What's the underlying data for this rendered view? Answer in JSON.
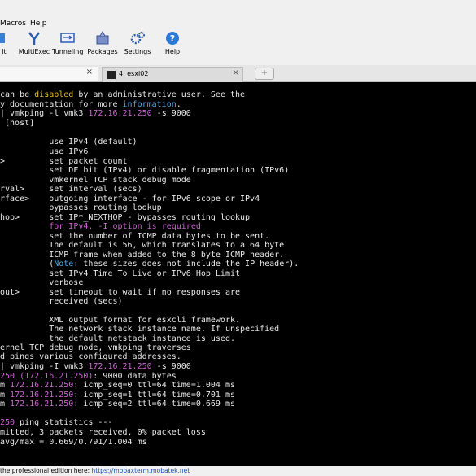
{
  "menubar": {
    "items": [
      "Macros",
      "Help"
    ]
  },
  "toolbar": {
    "buttons": [
      {
        "label": "it",
        "icon": "split-icon"
      },
      {
        "label": "MultiExec",
        "icon": "multiexec-icon"
      },
      {
        "label": "Tunneling",
        "icon": "tunneling-icon"
      },
      {
        "label": "Packages",
        "icon": "packages-icon"
      },
      {
        "label": "Settings",
        "icon": "settings-icon"
      },
      {
        "label": "Help",
        "icon": "help-icon"
      }
    ]
  },
  "tabs": {
    "active_close": "×",
    "session_tab": {
      "label": "4. esxi02",
      "close": "×"
    },
    "new_tab": "+"
  },
  "terminal": {
    "lines": [
      [
        {
          "t": "can be ",
          "c": "#e8e8e8"
        },
        {
          "t": "disabled",
          "c": "#e0c020"
        },
        {
          "t": " by an administrative user. See the",
          "c": "#e8e8e8"
        }
      ],
      [
        {
          "t": "y documentation for more ",
          "c": "#e8e8e8"
        },
        {
          "t": "information",
          "c": "#4aa8e8"
        },
        {
          "t": ".",
          "c": "#e8e8e8"
        }
      ],
      [
        {
          "t": "| vmkping -l vmk3 ",
          "c": "#e8e8e8"
        },
        {
          "t": "172.16.21.250",
          "c": "#d060d8"
        },
        {
          "t": " -s 9000",
          "c": "#e8e8e8"
        }
      ],
      [
        {
          "t": " [host]",
          "c": "#e8e8e8"
        }
      ],
      [
        {
          "t": "",
          "c": "#e8e8e8"
        }
      ],
      [
        {
          "t": "          use IPv4 (default)",
          "c": "#e8e8e8"
        }
      ],
      [
        {
          "t": "          use IPv6",
          "c": "#e8e8e8"
        }
      ],
      [
        {
          "t": ">         set packet count",
          "c": "#e8e8e8"
        }
      ],
      [
        {
          "t": "          set DF bit (IPv4) or disable fragmentation (IPv6)",
          "c": "#e8e8e8"
        }
      ],
      [
        {
          "t": "          vmkernel TCP stack debug mode",
          "c": "#e8e8e8"
        }
      ],
      [
        {
          "t": "rval>     set interval (secs)",
          "c": "#e8e8e8"
        }
      ],
      [
        {
          "t": "rface>    outgoing interface - for IPv6 scope or IPv4",
          "c": "#e8e8e8"
        }
      ],
      [
        {
          "t": "          bypasses routing lookup",
          "c": "#e8e8e8"
        }
      ],
      [
        {
          "t": "hop>      set IP*_NEXTHOP - bypasses routing lookup",
          "c": "#e8e8e8"
        }
      ],
      [
        {
          "t": "          ",
          "c": "#e8e8e8"
        },
        {
          "t": "for IPv4, -I option is required",
          "c": "#d060d8"
        }
      ],
      [
        {
          "t": "          set the number of ICMP data bytes to be sent.",
          "c": "#e8e8e8"
        }
      ],
      [
        {
          "t": "          The default is 56, which translates to a 64 byte",
          "c": "#e8e8e8"
        }
      ],
      [
        {
          "t": "          ICMP frame when added to the 8 byte ICMP header.",
          "c": "#e8e8e8"
        }
      ],
      [
        {
          "t": "          (",
          "c": "#e8e8e8"
        },
        {
          "t": "Note",
          "c": "#4aa8e8"
        },
        {
          "t": ": these sizes does not include the IP header).",
          "c": "#e8e8e8"
        }
      ],
      [
        {
          "t": "          set IPv4 Time To Live or IPv6 Hop Limit",
          "c": "#e8e8e8"
        }
      ],
      [
        {
          "t": "          verbose",
          "c": "#e8e8e8"
        }
      ],
      [
        {
          "t": "out>      set timeout to wait if no responses are",
          "c": "#e8e8e8"
        }
      ],
      [
        {
          "t": "          received (secs)",
          "c": "#e8e8e8"
        }
      ],
      [
        {
          "t": "",
          "c": "#e8e8e8"
        }
      ],
      [
        {
          "t": "          XML output format for esxcli framework.",
          "c": "#e8e8e8"
        }
      ],
      [
        {
          "t": "          The network stack instance name. If unspecified",
          "c": "#e8e8e8"
        }
      ],
      [
        {
          "t": "          the default netstack instance is used.",
          "c": "#e8e8e8"
        }
      ],
      [
        {
          "t": "ernel TCP debug mode, vmkping traverses",
          "c": "#e8e8e8"
        }
      ],
      [
        {
          "t": "d pings various configured addresses.",
          "c": "#e8e8e8"
        }
      ],
      [
        {
          "t": "| vmkping -I vmk3 ",
          "c": "#e8e8e8"
        },
        {
          "t": "172.16.21.250",
          "c": "#d060d8"
        },
        {
          "t": " -s 9000",
          "c": "#e8e8e8"
        }
      ],
      [
        {
          "t": "250 (172.16.21.250)",
          "c": "#d060d8"
        },
        {
          "t": ": 9000 data bytes",
          "c": "#e8e8e8"
        }
      ],
      [
        {
          "t": "m ",
          "c": "#e8e8e8"
        },
        {
          "t": "172.16.21.250",
          "c": "#d060d8"
        },
        {
          "t": ": icmp_seq=0 ttl=64 time=1.004 ms",
          "c": "#e8e8e8"
        }
      ],
      [
        {
          "t": "m ",
          "c": "#e8e8e8"
        },
        {
          "t": "172.16.21.250",
          "c": "#d060d8"
        },
        {
          "t": ": icmp_seq=1 ttl=64 time=0.701 ms",
          "c": "#e8e8e8"
        }
      ],
      [
        {
          "t": "m ",
          "c": "#e8e8e8"
        },
        {
          "t": "172.16.21.250",
          "c": "#d060d8"
        },
        {
          "t": ": icmp_seq=2 ttl=64 time=0.669 ms",
          "c": "#e8e8e8"
        }
      ],
      [
        {
          "t": "",
          "c": "#e8e8e8"
        }
      ],
      [
        {
          "t": "250",
          "c": "#d060d8"
        },
        {
          "t": " ping statistics ---",
          "c": "#e8e8e8"
        }
      ],
      [
        {
          "t": "mitted, 3 packets received, 0% packet loss",
          "c": "#e8e8e8"
        }
      ],
      [
        {
          "t": "avg/max = 0.669/0.791/1.004 ms",
          "c": "#e8e8e8"
        }
      ]
    ]
  },
  "statusbar": {
    "text": "the professional edition here: ",
    "link": "https://mobaxterm.mobatek.net"
  }
}
